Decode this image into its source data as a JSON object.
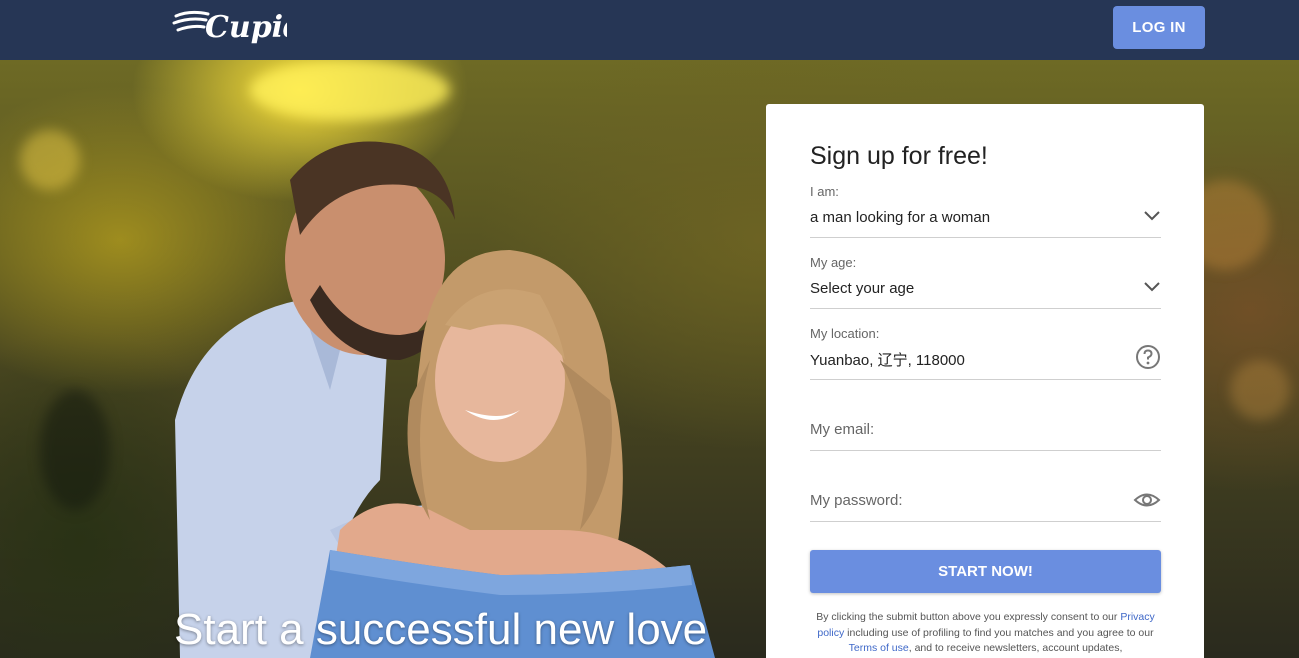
{
  "header": {
    "logo_text": "Cupid",
    "login_label": "LOG IN"
  },
  "hero": {
    "tagline": "Start a successful new love"
  },
  "signup": {
    "title": "Sign up for free!",
    "iam": {
      "label": "I am:",
      "value": "a man looking for a woman"
    },
    "age": {
      "label": "My age:",
      "value": "Select your age"
    },
    "location": {
      "label": "My location:",
      "value": "Yuanbao, 辽宁, 118000"
    },
    "email": {
      "placeholder": "My email:"
    },
    "password": {
      "placeholder": "My password:"
    },
    "submit_label": "START NOW!",
    "legal": {
      "part1": "By clicking the submit button above you expressly consent to our",
      "privacy_link": "Privacy policy",
      "part2": "including use of profiling to find you matches and you agree to our",
      "terms_link": "Terms of use",
      "part3": ", and to receive newsletters, account updates,"
    }
  },
  "colors": {
    "header_bg": "#263655",
    "accent": "#6a8ee0",
    "link": "#3f68c8"
  },
  "icons": [
    "cupid-wings-logo",
    "chevron-down-icon",
    "help-circle-icon",
    "eye-icon"
  ]
}
